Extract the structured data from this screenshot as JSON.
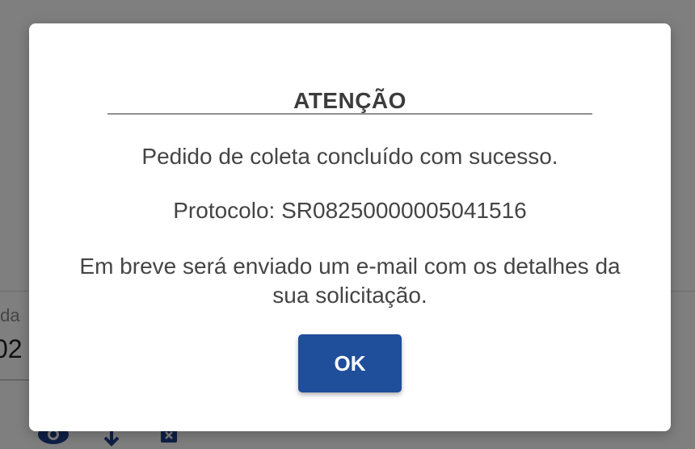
{
  "background": {
    "field_label": "ída",
    "field_value": "02",
    "icons": [
      "eye-icon",
      "download-icon",
      "delete-icon"
    ]
  },
  "dialog": {
    "title": "ATENÇÃO",
    "message_success": "Pedido de coleta concluído com sucesso.",
    "message_protocol": "Protocolo: SR08250000005041516",
    "message_email": "Em breve será enviado um e-mail com os detalhes da sua solicitação.",
    "ok_label": "OK"
  },
  "colors": {
    "accent": "#1f4e9a",
    "overlay": "rgba(0,0,0,0.5)"
  }
}
